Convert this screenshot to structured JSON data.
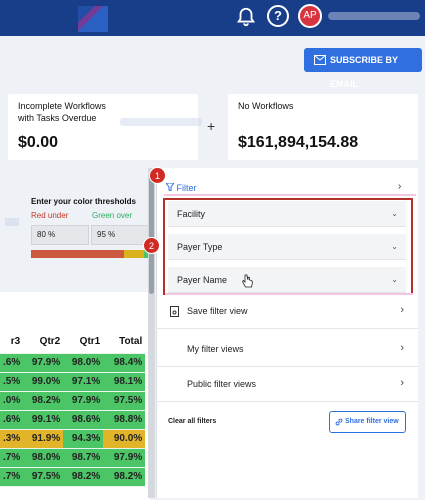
{
  "topbar": {
    "help_label": "?",
    "avatar_initials": "AP"
  },
  "subscribe": {
    "label": "SUBSCRIBE BY EMAIL"
  },
  "cards": [
    {
      "label_line1": "Incomplete Workflows",
      "label_line2": "with Tasks Overdue",
      "value": "$0.00"
    },
    {
      "label_line1": "No Workflows",
      "label_line2": "",
      "value": "$161,894,154.88"
    }
  ],
  "plus": "+",
  "thresholds": {
    "title": "Enter your color thresholds",
    "red_label": "Red under",
    "green_label": "Green over",
    "red_value": "80 %",
    "green_value": "95 %"
  },
  "table": {
    "headers": [
      "r3",
      "Qtr2",
      "Qtr1",
      "Total"
    ],
    "rows": [
      [
        ".6%",
        "97.9%",
        "98.0%",
        "98.4%"
      ],
      [
        ".5%",
        "99.0%",
        "97.1%",
        "98.1%"
      ],
      [
        ".0%",
        "98.2%",
        "97.9%",
        "97.5%"
      ],
      [
        ".6%",
        "99.1%",
        "98.6%",
        "98.8%"
      ],
      [
        ".3%",
        "91.9%",
        "94.3%",
        "90.0%"
      ],
      [
        ".7%",
        "98.0%",
        "98.7%",
        "97.9%"
      ],
      [
        ".7%",
        "97.5%",
        "98.2%",
        "98.2%"
      ]
    ],
    "rows_highlight": [
      4
    ]
  },
  "filter": {
    "title": "Filter",
    "items": [
      "Facility",
      "Payer Type",
      "Payer Name"
    ],
    "badge1": "1",
    "badge2": "2",
    "save_view": "Save filter view",
    "my_views": "My filter views",
    "public_views": "Public filter views",
    "clear_all": "Clear all filters",
    "share": "Share filter view"
  },
  "colors": {
    "header_bg": "#183d89",
    "accent": "#2f6fe0",
    "green": "#4cc566",
    "yellow": "#e2b42a",
    "red": "#d02a25"
  }
}
